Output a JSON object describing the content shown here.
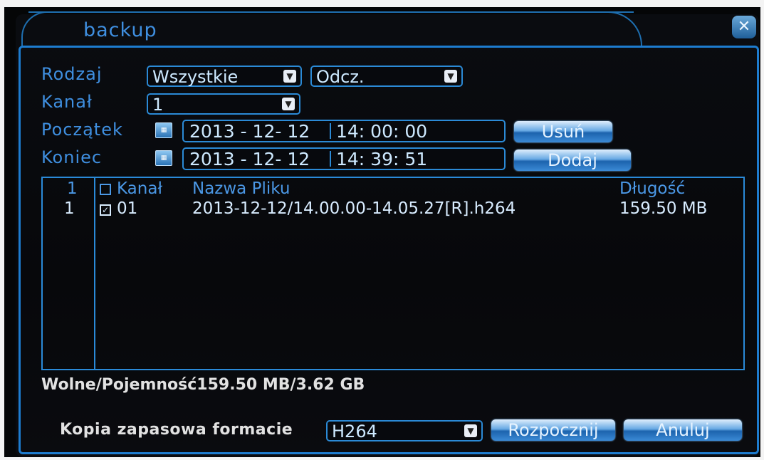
{
  "dialog": {
    "title": "backup",
    "close_icon": "close-icon"
  },
  "filters": {
    "type_label": "Rodzaj",
    "type_value": "Wszystkie",
    "mode_value": "Odcz.",
    "channel_label": "Kanał",
    "channel_value": "1",
    "start_label": "Początek",
    "start_date": "2013 - 12- 12",
    "start_time": "14: 00: 00",
    "end_label": "Koniec",
    "end_date": "2013 - 12- 12",
    "end_time": "14: 39: 51",
    "remove_button": "Usuń",
    "add_button": "Dodaj"
  },
  "file_list": {
    "headers": {
      "index": "1",
      "channel": "Kanał",
      "filename": "Nazwa Pliku",
      "length": "Długość"
    },
    "rows": [
      {
        "index": "1",
        "checked": true,
        "channel": "01",
        "filename": "2013-12-12/14.00.00-14.05.27[R].h264",
        "length": "159.50 MB"
      }
    ]
  },
  "capacity": "Wolne/Pojemność159.50 MB/3.62 GB",
  "footer": {
    "format_label": "Kopia zapasowa formacie",
    "format_value": "H264",
    "start_button": "Rozpocznij",
    "cancel_button": "Anuluj"
  },
  "colors": {
    "accent": "#2b8ad6",
    "label": "#3f8fe0",
    "background": "#050607"
  }
}
